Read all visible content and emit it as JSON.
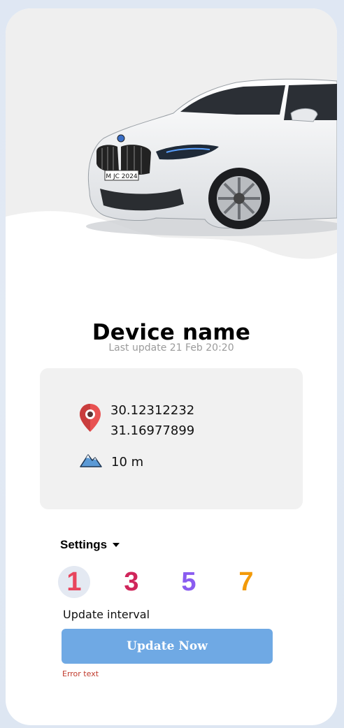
{
  "device": {
    "title": "Device name",
    "last_update": "Last update 21 Feb 20:20",
    "plate": "M JC 2024"
  },
  "location": {
    "latitude": "30.12312232",
    "longitude": "31.16977899",
    "altitude": "10 m"
  },
  "settings": {
    "label": "Settings",
    "interval_options": [
      "1",
      "3",
      "5",
      "7"
    ],
    "selected_option": "1",
    "interval_label": "Update interval",
    "update_button": "Update Now",
    "error_text": "Error text"
  },
  "icons": {
    "location": "map-pin-icon",
    "altitude": "mountain-icon",
    "dropdown": "caret-down-icon"
  },
  "colors": {
    "button": "#6fa9e4",
    "error": "#c0392b",
    "pin": "#e85252",
    "option_1": "#e8455d",
    "option_3": "#d0265b",
    "option_5": "#8a5cf0",
    "option_7": "#f29a0a"
  }
}
